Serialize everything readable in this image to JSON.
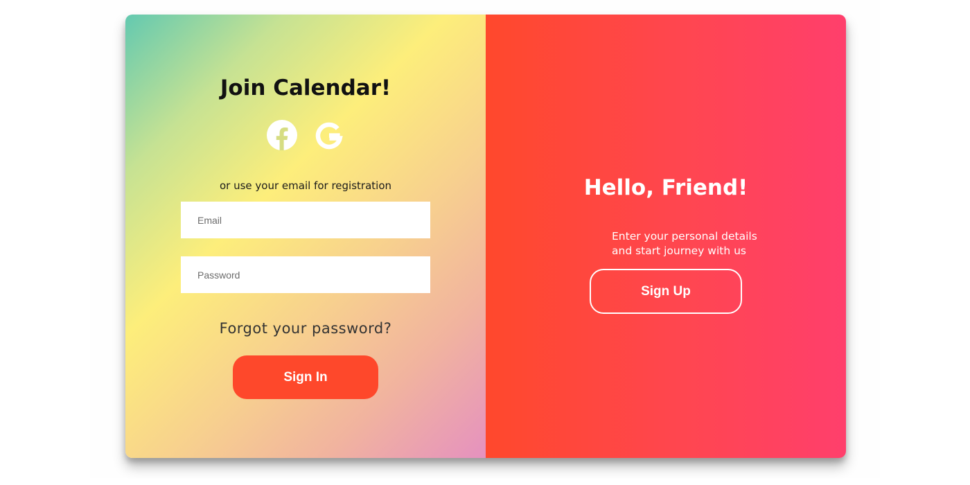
{
  "signin": {
    "title": "Join Calendar!",
    "social_icons": [
      "facebook-icon",
      "google-icon"
    ],
    "helper_text": "or use your email for registration",
    "email_placeholder": "Email",
    "password_placeholder": "Password",
    "forgot_label": "Forgot your password?",
    "signin_label": "Sign In"
  },
  "overlay": {
    "title": "Hello, Friend!",
    "subtitle_line1": "Enter your personal details",
    "subtitle_line2": "and start journey with us",
    "signup_label": "Sign Up"
  },
  "colors": {
    "primary_accent": "#fe482b",
    "overlay_gradient_start": "#ff482c",
    "overlay_gradient_end": "#ff3f6c",
    "text_light": "#ffffff",
    "text_dark": "#111111"
  }
}
